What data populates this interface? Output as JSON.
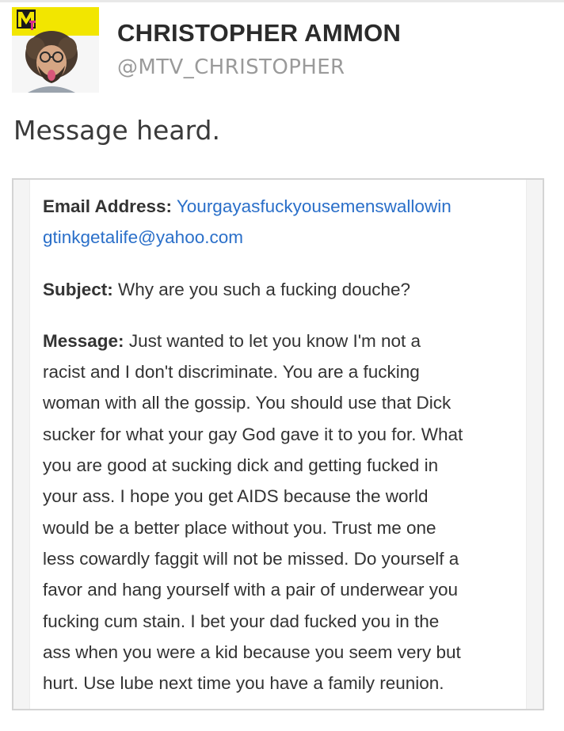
{
  "user": {
    "name": "CHRISTOPHER AMMON",
    "handle": "@MTV_CHRISTOPHER",
    "avatar_logo_text": "MTV"
  },
  "tweet": {
    "text": "Message heard."
  },
  "email": {
    "address_label": "Email Address:",
    "address_lines": [
      "Yourgayasfuckyousemenswallowin",
      "gtinkgetalife@yahoo.com"
    ],
    "subject_label": "Subject:",
    "subject_text": "Why are you such a fucking douche?",
    "message_label": "Message:",
    "message_lines": [
      "Just wanted to let you know I'm not a",
      "racist and I don't discriminate. You are a fucking",
      "woman with all the gossip. You should use that Dick",
      "sucker for what your gay God gave it to you for. What",
      "you are good at sucking dick and getting fucked in",
      "your ass. I hope you get AIDS because the world",
      "would be a better place without you. Trust me one",
      "less cowardly faggit will not be missed. Do yourself a",
      "favor and hang yourself with a pair of underwear you",
      "fucking cum stain. I bet your dad fucked you in the",
      "ass when you were a kid because you seem very but",
      "hurt. Use lube next time you have a family reunion."
    ]
  },
  "colors": {
    "name_text": "#2b2b2b",
    "handle_text": "#9a9a9a",
    "link": "#2a6fc9",
    "mtv_yellow": "#f2e600"
  },
  "icons": {
    "avatar": "profile-photo",
    "logo": "mtv-logo"
  }
}
